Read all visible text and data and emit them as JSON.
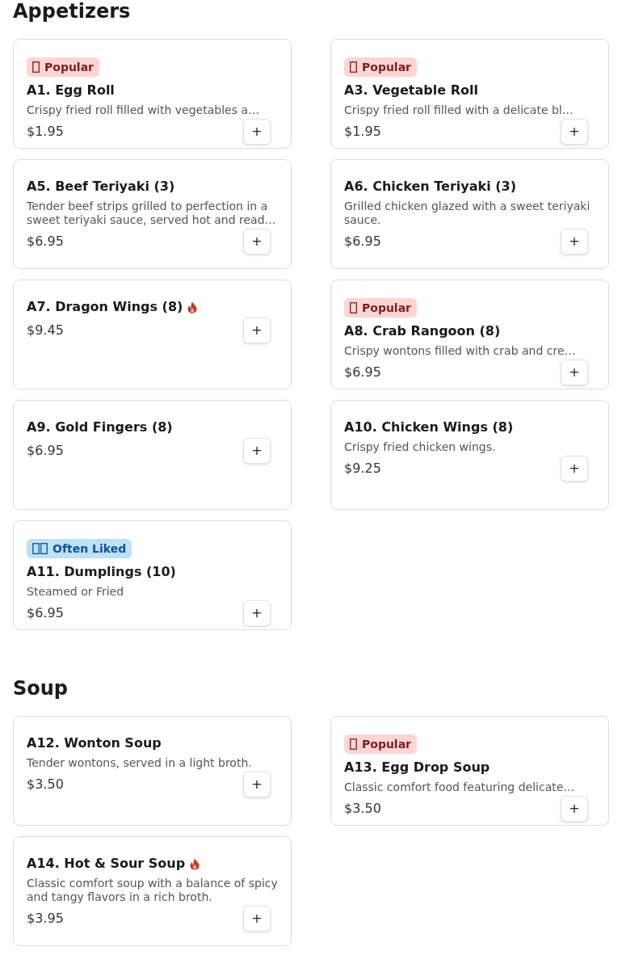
{
  "sections": [
    {
      "title": "Appetizers",
      "items": [
        {
          "name": "A1. Egg Roll",
          "badge": {
            "kind": "popular",
            "label": "Popular"
          },
          "description": "Crispy fried roll filled with vegetables a…",
          "price": "$1.95",
          "spicy": false,
          "add_label": "+"
        },
        {
          "name": "A3. Vegetable Roll",
          "badge": {
            "kind": "popular",
            "label": "Popular"
          },
          "description": "Crispy fried roll filled with a delicate bl…",
          "price": "$1.95",
          "spicy": false,
          "add_label": "+"
        },
        {
          "name": "A5. Beef Teriyaki (3)",
          "description": "Tender beef strips grilled to perfection in a sweet teriyaki sauce, served hot and read…",
          "price": "$6.95",
          "spicy": false,
          "add_label": "+"
        },
        {
          "name": "A6. Chicken Teriyaki (3)",
          "description": "Grilled chicken glazed with a sweet teriyaki sauce.",
          "price": "$6.95",
          "spicy": false,
          "add_label": "+"
        },
        {
          "name": "A7. Dragon Wings (8)",
          "price": "$9.45",
          "spicy": true,
          "add_label": "+"
        },
        {
          "name": "A8. Crab Rangoon (8)",
          "badge": {
            "kind": "popular",
            "label": "Popular"
          },
          "description": "Crispy wontons filled with crab and cre…",
          "price": "$6.95",
          "spicy": false,
          "add_label": "+"
        },
        {
          "name": "A9. Gold Fingers (8)",
          "price": "$6.95",
          "spicy": false,
          "add_label": "+"
        },
        {
          "name": "A10. Chicken Wings (8)",
          "description": "Crispy fried chicken wings.",
          "price": "$9.25",
          "spicy": false,
          "add_label": "+"
        },
        {
          "name": "A11. Dumplings (10)",
          "badge": {
            "kind": "often_liked",
            "label": "Often Liked"
          },
          "description": "Steamed or Fried",
          "price": "$6.95",
          "spicy": false,
          "add_label": "+"
        }
      ]
    },
    {
      "title": "Soup",
      "items": [
        {
          "name": "A12. Wonton Soup",
          "description": "Tender wontons, served in a light broth.",
          "price": "$3.50",
          "spicy": false,
          "add_label": "+"
        },
        {
          "name": "A13. Egg Drop Soup",
          "badge": {
            "kind": "popular",
            "label": "Popular"
          },
          "description": "Classic comfort food featuring delicate…",
          "price": "$3.50",
          "spicy": false,
          "add_label": "+"
        },
        {
          "name": "A14. Hot & Sour Soup",
          "description": "Classic comfort soup with a balance of spicy and tangy flavors in a rich broth.",
          "price": "$3.95",
          "spicy": true,
          "add_label": "+"
        }
      ]
    }
  ]
}
